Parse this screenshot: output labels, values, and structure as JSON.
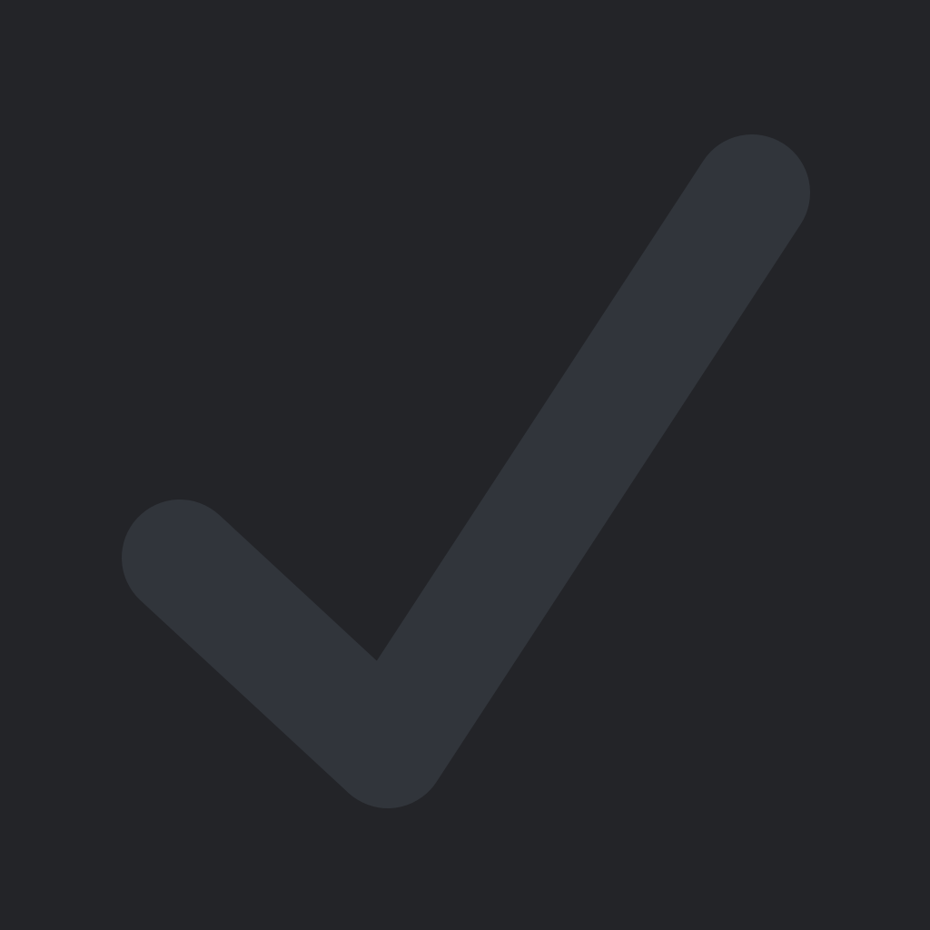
{
  "colors": {
    "background": "#232428",
    "icon": "#31353b"
  },
  "icon": {
    "name": "check-icon"
  }
}
